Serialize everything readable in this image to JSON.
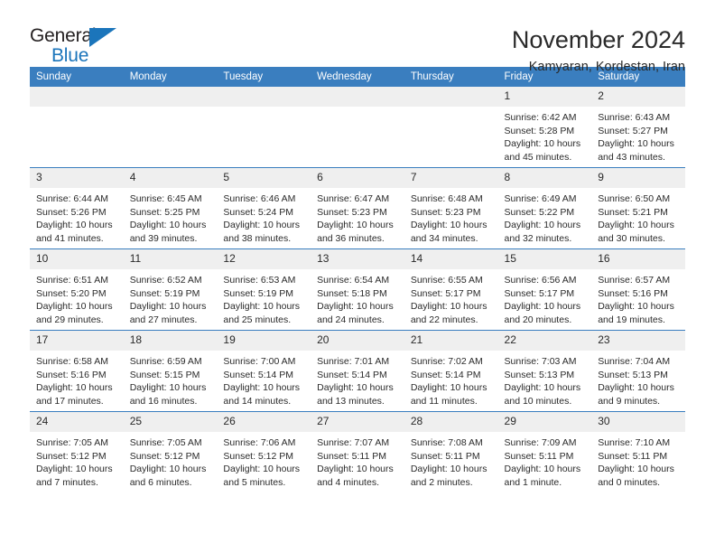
{
  "brand": {
    "name_part1": "General",
    "name_part2": "Blue",
    "accent_color": "#1b75bb"
  },
  "header": {
    "title": "November 2024",
    "subtitle": "Kamyaran, Kordestan, Iran",
    "header_bg_color": "#3a7ebf",
    "daynum_bg_color": "#efefef"
  },
  "weekdays": [
    "Sunday",
    "Monday",
    "Tuesday",
    "Wednesday",
    "Thursday",
    "Friday",
    "Saturday"
  ],
  "labels": {
    "sunrise": "Sunrise:",
    "sunset": "Sunset:",
    "daylight": "Daylight:"
  },
  "weeks": [
    [
      {
        "day": "",
        "blank": true
      },
      {
        "day": "",
        "blank": true
      },
      {
        "day": "",
        "blank": true
      },
      {
        "day": "",
        "blank": true
      },
      {
        "day": "",
        "blank": true
      },
      {
        "day": "1",
        "sunrise": "Sunrise: 6:42 AM",
        "sunset": "Sunset: 5:28 PM",
        "daylight": "Daylight: 10 hours and 45 minutes."
      },
      {
        "day": "2",
        "sunrise": "Sunrise: 6:43 AM",
        "sunset": "Sunset: 5:27 PM",
        "daylight": "Daylight: 10 hours and 43 minutes."
      }
    ],
    [
      {
        "day": "3",
        "sunrise": "Sunrise: 6:44 AM",
        "sunset": "Sunset: 5:26 PM",
        "daylight": "Daylight: 10 hours and 41 minutes."
      },
      {
        "day": "4",
        "sunrise": "Sunrise: 6:45 AM",
        "sunset": "Sunset: 5:25 PM",
        "daylight": "Daylight: 10 hours and 39 minutes."
      },
      {
        "day": "5",
        "sunrise": "Sunrise: 6:46 AM",
        "sunset": "Sunset: 5:24 PM",
        "daylight": "Daylight: 10 hours and 38 minutes."
      },
      {
        "day": "6",
        "sunrise": "Sunrise: 6:47 AM",
        "sunset": "Sunset: 5:23 PM",
        "daylight": "Daylight: 10 hours and 36 minutes."
      },
      {
        "day": "7",
        "sunrise": "Sunrise: 6:48 AM",
        "sunset": "Sunset: 5:23 PM",
        "daylight": "Daylight: 10 hours and 34 minutes."
      },
      {
        "day": "8",
        "sunrise": "Sunrise: 6:49 AM",
        "sunset": "Sunset: 5:22 PM",
        "daylight": "Daylight: 10 hours and 32 minutes."
      },
      {
        "day": "9",
        "sunrise": "Sunrise: 6:50 AM",
        "sunset": "Sunset: 5:21 PM",
        "daylight": "Daylight: 10 hours and 30 minutes."
      }
    ],
    [
      {
        "day": "10",
        "sunrise": "Sunrise: 6:51 AM",
        "sunset": "Sunset: 5:20 PM",
        "daylight": "Daylight: 10 hours and 29 minutes."
      },
      {
        "day": "11",
        "sunrise": "Sunrise: 6:52 AM",
        "sunset": "Sunset: 5:19 PM",
        "daylight": "Daylight: 10 hours and 27 minutes."
      },
      {
        "day": "12",
        "sunrise": "Sunrise: 6:53 AM",
        "sunset": "Sunset: 5:19 PM",
        "daylight": "Daylight: 10 hours and 25 minutes."
      },
      {
        "day": "13",
        "sunrise": "Sunrise: 6:54 AM",
        "sunset": "Sunset: 5:18 PM",
        "daylight": "Daylight: 10 hours and 24 minutes."
      },
      {
        "day": "14",
        "sunrise": "Sunrise: 6:55 AM",
        "sunset": "Sunset: 5:17 PM",
        "daylight": "Daylight: 10 hours and 22 minutes."
      },
      {
        "day": "15",
        "sunrise": "Sunrise: 6:56 AM",
        "sunset": "Sunset: 5:17 PM",
        "daylight": "Daylight: 10 hours and 20 minutes."
      },
      {
        "day": "16",
        "sunrise": "Sunrise: 6:57 AM",
        "sunset": "Sunset: 5:16 PM",
        "daylight": "Daylight: 10 hours and 19 minutes."
      }
    ],
    [
      {
        "day": "17",
        "sunrise": "Sunrise: 6:58 AM",
        "sunset": "Sunset: 5:16 PM",
        "daylight": "Daylight: 10 hours and 17 minutes."
      },
      {
        "day": "18",
        "sunrise": "Sunrise: 6:59 AM",
        "sunset": "Sunset: 5:15 PM",
        "daylight": "Daylight: 10 hours and 16 minutes."
      },
      {
        "day": "19",
        "sunrise": "Sunrise: 7:00 AM",
        "sunset": "Sunset: 5:14 PM",
        "daylight": "Daylight: 10 hours and 14 minutes."
      },
      {
        "day": "20",
        "sunrise": "Sunrise: 7:01 AM",
        "sunset": "Sunset: 5:14 PM",
        "daylight": "Daylight: 10 hours and 13 minutes."
      },
      {
        "day": "21",
        "sunrise": "Sunrise: 7:02 AM",
        "sunset": "Sunset: 5:14 PM",
        "daylight": "Daylight: 10 hours and 11 minutes."
      },
      {
        "day": "22",
        "sunrise": "Sunrise: 7:03 AM",
        "sunset": "Sunset: 5:13 PM",
        "daylight": "Daylight: 10 hours and 10 minutes."
      },
      {
        "day": "23",
        "sunrise": "Sunrise: 7:04 AM",
        "sunset": "Sunset: 5:13 PM",
        "daylight": "Daylight: 10 hours and 9 minutes."
      }
    ],
    [
      {
        "day": "24",
        "sunrise": "Sunrise: 7:05 AM",
        "sunset": "Sunset: 5:12 PM",
        "daylight": "Daylight: 10 hours and 7 minutes."
      },
      {
        "day": "25",
        "sunrise": "Sunrise: 7:05 AM",
        "sunset": "Sunset: 5:12 PM",
        "daylight": "Daylight: 10 hours and 6 minutes."
      },
      {
        "day": "26",
        "sunrise": "Sunrise: 7:06 AM",
        "sunset": "Sunset: 5:12 PM",
        "daylight": "Daylight: 10 hours and 5 minutes."
      },
      {
        "day": "27",
        "sunrise": "Sunrise: 7:07 AM",
        "sunset": "Sunset: 5:11 PM",
        "daylight": "Daylight: 10 hours and 4 minutes."
      },
      {
        "day": "28",
        "sunrise": "Sunrise: 7:08 AM",
        "sunset": "Sunset: 5:11 PM",
        "daylight": "Daylight: 10 hours and 2 minutes."
      },
      {
        "day": "29",
        "sunrise": "Sunrise: 7:09 AM",
        "sunset": "Sunset: 5:11 PM",
        "daylight": "Daylight: 10 hours and 1 minute."
      },
      {
        "day": "30",
        "sunrise": "Sunrise: 7:10 AM",
        "sunset": "Sunset: 5:11 PM",
        "daylight": "Daylight: 10 hours and 0 minutes."
      }
    ]
  ]
}
